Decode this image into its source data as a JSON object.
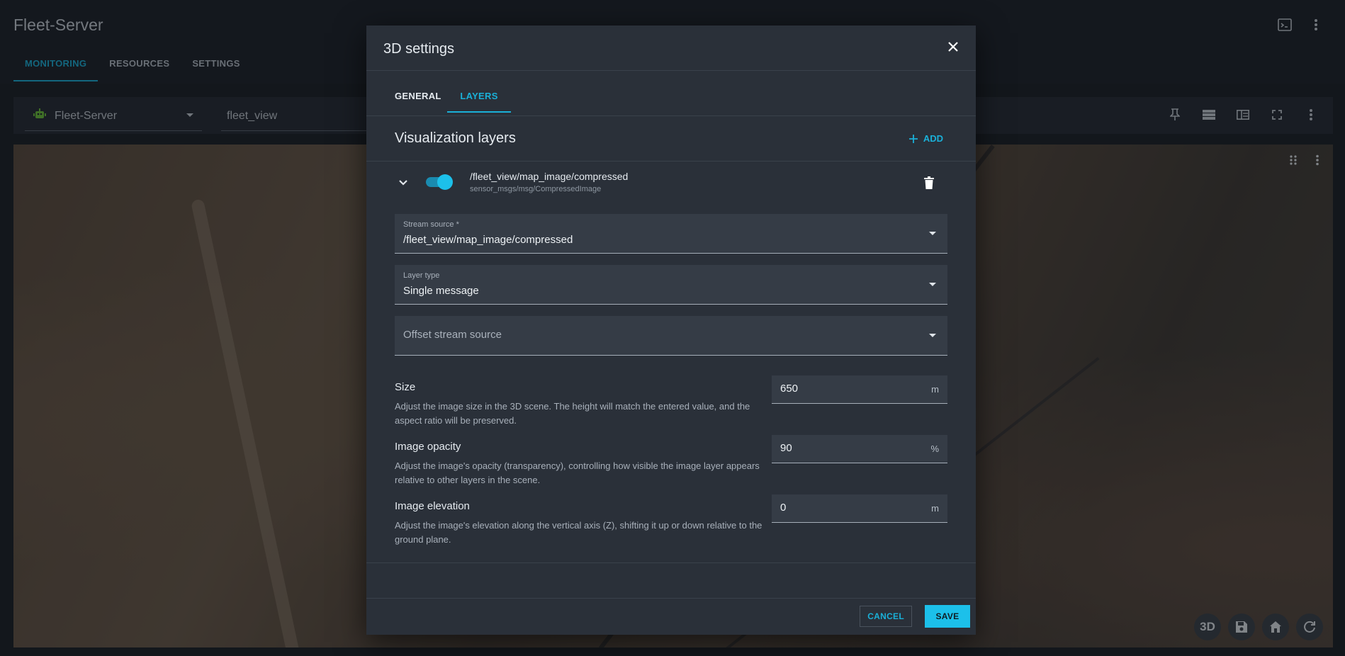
{
  "app": {
    "title": "Fleet-Server",
    "tabs": [
      "MONITORING",
      "RESOURCES",
      "SETTINGS"
    ],
    "active_tab": "MONITORING",
    "header_icons": [
      "terminal-icon",
      "more-vert-icon"
    ]
  },
  "toolbar": {
    "robot_select": "Fleet-Server",
    "view_name": "fleet_view",
    "icons": [
      "pin-icon",
      "rows-icon",
      "split-view-icon",
      "fullscreen-icon",
      "more-vert-icon"
    ]
  },
  "map": {
    "top_controls": [
      "drag-handle-icon",
      "more-vert-icon"
    ],
    "bottom_controls": {
      "mode_3d": "3D",
      "icons": [
        "save-icon",
        "home-icon",
        "refresh-icon"
      ]
    }
  },
  "dialog": {
    "title": "3D settings",
    "tabs": {
      "general": "GENERAL",
      "layers": "LAYERS"
    },
    "active_tab": "LAYERS",
    "section_title": "Visualization layers",
    "add_label": "ADD",
    "layer": {
      "enabled": true,
      "path": "/fleet_view/map_image/compressed",
      "msg_type": "sensor_msgs/msg/CompressedImage"
    },
    "fields": {
      "stream_source": {
        "label": "Stream source *",
        "value": "/fleet_view/map_image/compressed"
      },
      "layer_type": {
        "label": "Layer type",
        "value": "Single message"
      },
      "offset_stream_source": {
        "placeholder": "Offset stream source"
      }
    },
    "settings": {
      "size": {
        "name": "Size",
        "description": "Adjust the image size in the 3D scene. The height will match the entered value, and the aspect ratio will be preserved.",
        "value": "650",
        "unit": "m"
      },
      "opacity": {
        "name": "Image opacity",
        "description": "Adjust the image's opacity (transparency), controlling how visible the image layer appears relative to other layers in the scene.",
        "value": "90",
        "unit": "%"
      },
      "elevation": {
        "name": "Image elevation",
        "description": "Adjust the image's elevation along the vertical axis (Z), shifting it up or down relative to the ground plane.",
        "value": "0",
        "unit": "m"
      }
    },
    "buttons": {
      "cancel": "CANCEL",
      "save": "SAVE"
    }
  },
  "colors": {
    "accent": "#1ab0d8",
    "save_bg": "#1cc0ea",
    "dialog_bg": "#2a3039"
  }
}
